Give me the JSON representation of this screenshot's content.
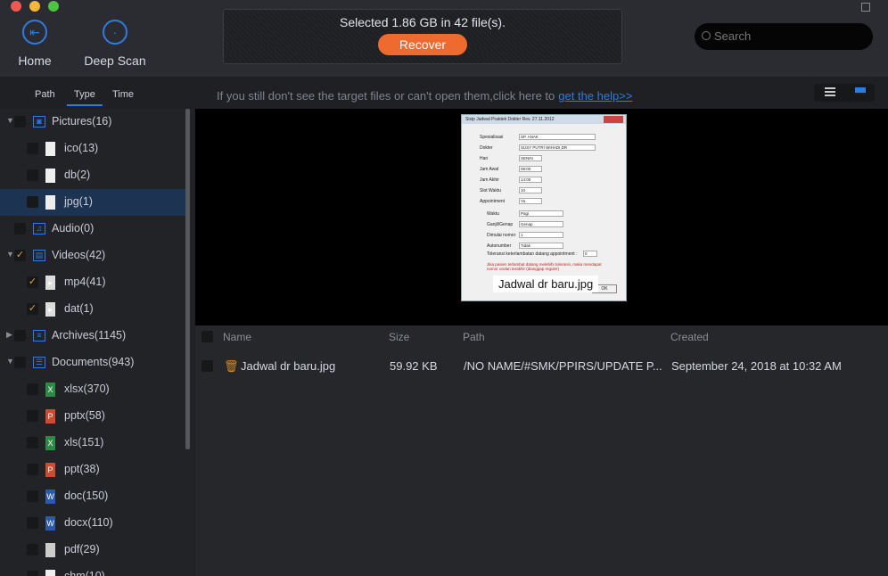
{
  "toolbar": {
    "home": "Home",
    "deep_scan": "Deep Scan",
    "status": "Selected 1.86 GB in 42 file(s).",
    "recover": "Recover",
    "search_placeholder": "Search"
  },
  "tabs": {
    "path": "Path",
    "type": "Type",
    "time": "Time"
  },
  "help": {
    "text": "If you still don't see the target files or can't open them,click here to",
    "link": "get the help>>"
  },
  "tree": [
    {
      "label": "Pictures(16)",
      "level": 0,
      "expanded": true,
      "checked": false,
      "icon": "camera-icon"
    },
    {
      "label": "ico(13)",
      "level": 1,
      "checked": false,
      "icon": "file-icon"
    },
    {
      "label": "db(2)",
      "level": 1,
      "checked": false,
      "icon": "file-icon"
    },
    {
      "label": "jpg(1)",
      "level": 1,
      "checked": false,
      "icon": "file-icon",
      "selected": true
    },
    {
      "label": "Audio(0)",
      "level": 0,
      "checked": false,
      "icon": "music-icon"
    },
    {
      "label": "Videos(42)",
      "level": 0,
      "expanded": true,
      "checked": true,
      "icon": "film-icon"
    },
    {
      "label": "mp4(41)",
      "level": 1,
      "checked": true,
      "icon": "video-file-icon"
    },
    {
      "label": "dat(1)",
      "level": 1,
      "checked": true,
      "icon": "video-file-icon"
    },
    {
      "label": "Archives(1145)",
      "level": 0,
      "expanded": false,
      "checked": false,
      "icon": "archive-icon"
    },
    {
      "label": "Documents(943)",
      "level": 0,
      "expanded": true,
      "checked": false,
      "icon": "document-icon"
    },
    {
      "label": "xlsx(370)",
      "level": 1,
      "checked": false,
      "icon": "excel-icon"
    },
    {
      "label": "pptx(58)",
      "level": 1,
      "checked": false,
      "icon": "powerpoint-icon"
    },
    {
      "label": "xls(151)",
      "level": 1,
      "checked": false,
      "icon": "excel-icon"
    },
    {
      "label": "ppt(38)",
      "level": 1,
      "checked": false,
      "icon": "powerpoint-icon"
    },
    {
      "label": "doc(150)",
      "level": 1,
      "checked": false,
      "icon": "word-icon"
    },
    {
      "label": "docx(110)",
      "level": 1,
      "checked": false,
      "icon": "word-icon"
    },
    {
      "label": "pdf(29)",
      "level": 1,
      "checked": false,
      "icon": "pdf-icon"
    },
    {
      "label": "chm(10)",
      "level": 1,
      "checked": false,
      "icon": "file-icon"
    }
  ],
  "preview": {
    "caption": "Jadwal dr baru.jpg",
    "dialog_title": "Sisip Jadwal Praktek Dokter      Rev. 27.11.2012",
    "fields": [
      [
        "Spesialisasi",
        "SP. ANAK"
      ],
      [
        "Dokter",
        "SUSY PUTRI WIHADI,DR"
      ],
      [
        "Hari",
        "SENIN"
      ],
      [
        "Jam Awal",
        "08:00"
      ],
      [
        "Jam Akhir",
        "14:00"
      ],
      [
        "Slot Waktu",
        "10"
      ],
      [
        "Appointment",
        "Ya"
      ],
      [
        "Waktu",
        "Pagi"
      ],
      [
        "Ganjil/Genap",
        "Genap"
      ],
      [
        "Dimulai nomor",
        "1"
      ],
      [
        "Autonumber",
        "Tidak"
      ],
      [
        "Toleransi keterlambatan datang appointment :",
        "0"
      ]
    ],
    "note": "Jika pasien terlambat datang melebihi toleransi, maka mendapat nomor urutan terakhir (dianggap reguler)",
    "ok": "OK"
  },
  "table": {
    "headers": [
      "Name",
      "Size",
      "Path",
      "Created"
    ],
    "rows": [
      {
        "name": "Jadwal dr baru.jpg",
        "size": "59.92 KB",
        "path": "/NO NAME/#SMK/PPIRS/UPDATE P...",
        "created": "September 24, 2018 at 10:32 AM"
      }
    ]
  },
  "colors": {
    "accent": "#2f7be0",
    "recover": "#ef6a2e"
  }
}
